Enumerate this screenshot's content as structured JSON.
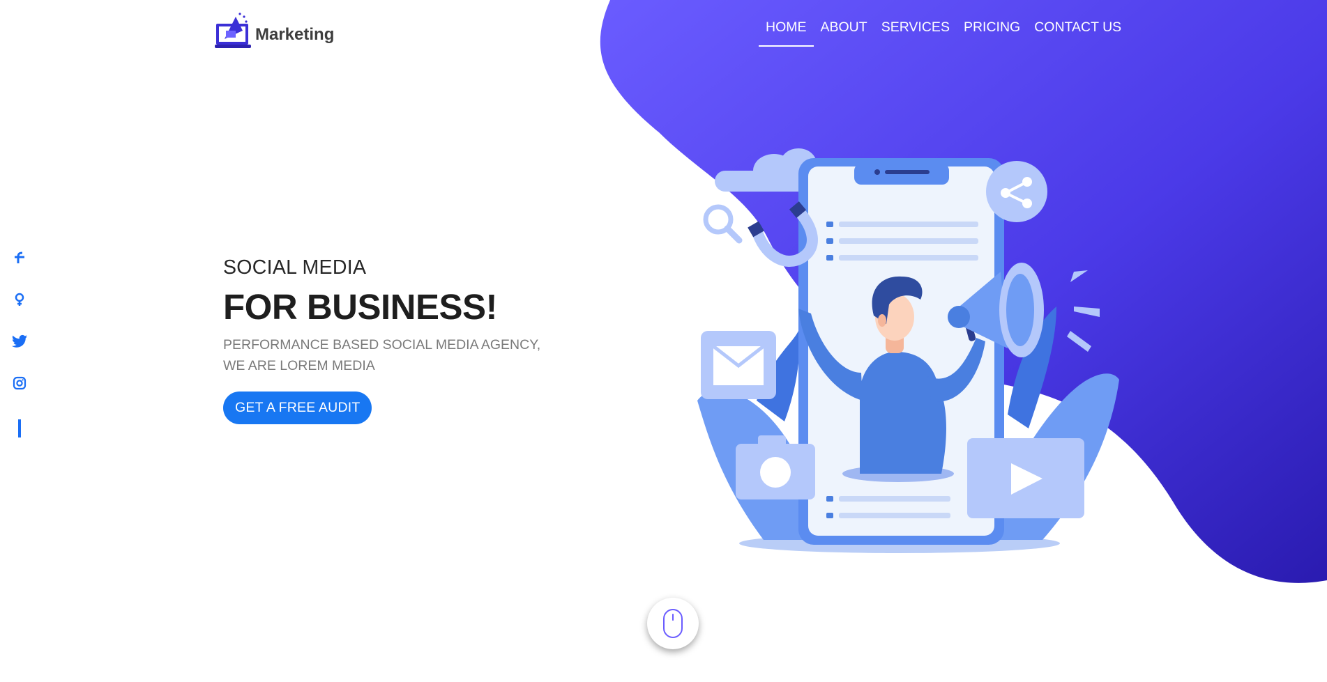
{
  "brand": {
    "name": "Marketing"
  },
  "nav": {
    "items": [
      {
        "label": "HOME",
        "active": true
      },
      {
        "label": "ABOUT",
        "active": false
      },
      {
        "label": "SERVICES",
        "active": false
      },
      {
        "label": "PRICING",
        "active": false
      },
      {
        "label": "CONTACT US",
        "active": false
      }
    ]
  },
  "social": {
    "icons": [
      "facebook-icon",
      "google-plus-icon",
      "twitter-icon",
      "instagram-icon"
    ]
  },
  "hero": {
    "kicker": "SOCIAL MEDIA",
    "headline": "FOR BUSINESS!",
    "subtitle_line1": "PERFORMANCE BASED SOCIAL MEDIA AGENCY,",
    "subtitle_line2": "WE ARE LOREM MEDIA",
    "cta_label": "GET A FREE AUDIT"
  },
  "colors": {
    "accent": "#1877f2",
    "blob_top": "#6659fb",
    "blob_bottom": "#2b1cb5",
    "illustration": "#4a7fe0"
  },
  "scroll_indicator": {
    "icon": "mouse-icon"
  }
}
